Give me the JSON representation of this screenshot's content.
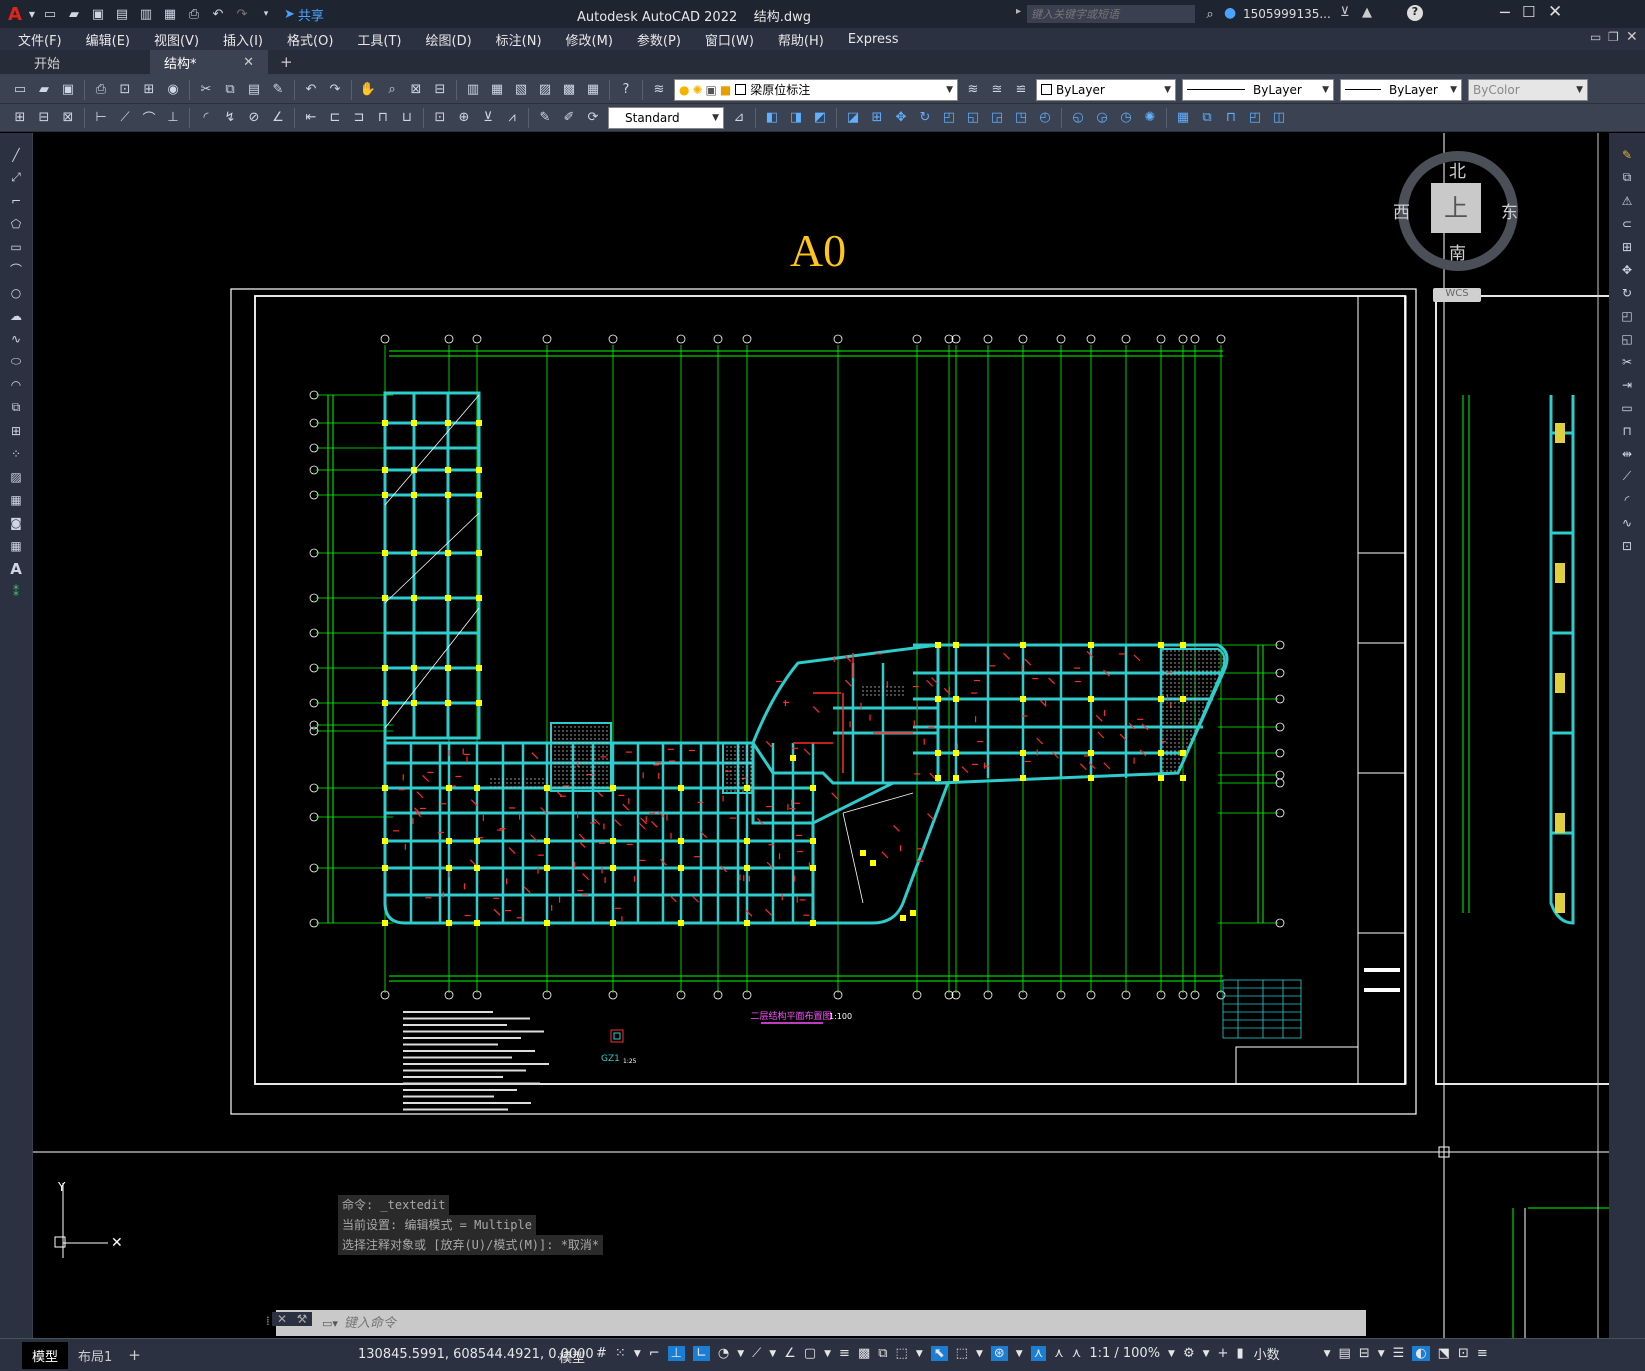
{
  "app": {
    "logo": "A",
    "title": "Autodesk AutoCAD 2022    结构.dwg",
    "share": "共享",
    "search_placeholder": "键入关键字或短语",
    "user": "1505999135...",
    "help": "?"
  },
  "menu": [
    "文件(F)",
    "编辑(E)",
    "视图(V)",
    "插入(I)",
    "格式(O)",
    "工具(T)",
    "绘图(D)",
    "标注(N)",
    "修改(M)",
    "参数(P)",
    "窗口(W)",
    "帮助(H)",
    "Express"
  ],
  "tabs": [
    {
      "label": "开始"
    },
    {
      "label": "结构*"
    }
  ],
  "toolbar": {
    "layer": "梁原位标注",
    "color": "ByLayer",
    "linetype": "ByLayer",
    "lineweight": "ByLayer",
    "plotstyle": "ByColor",
    "textstyle": "Standard"
  },
  "viewcube": {
    "north": "北",
    "south": "南",
    "east": "东",
    "west": "西",
    "face": "上",
    "wcs": "WCS"
  },
  "drawing": {
    "sheet_label": "A0",
    "plan_title": "二层结构平面布置图",
    "plan_scale": "1:100",
    "detail_label": "GZ1",
    "detail_scale": "1:25"
  },
  "command": {
    "history": [
      "命令: _textedit",
      "当前设置: 编辑模式 = Multiple",
      "选择注释对象或 [放弃(U)/模式(M)]: *取消*"
    ],
    "placeholder": "键入命令"
  },
  "layout_tabs": [
    "模型",
    "布局1"
  ],
  "status": {
    "coords": "130845.5991, 608544.4921, 0.0000",
    "model": "模型",
    "scale": "1:1 / 100%",
    "units": "小数"
  },
  "colors": {
    "accent": "#1a7fd4",
    "beam": "#33d6d6",
    "axis": "#00ff00",
    "dim": "#ff2b2b",
    "col": "#ffff00"
  }
}
